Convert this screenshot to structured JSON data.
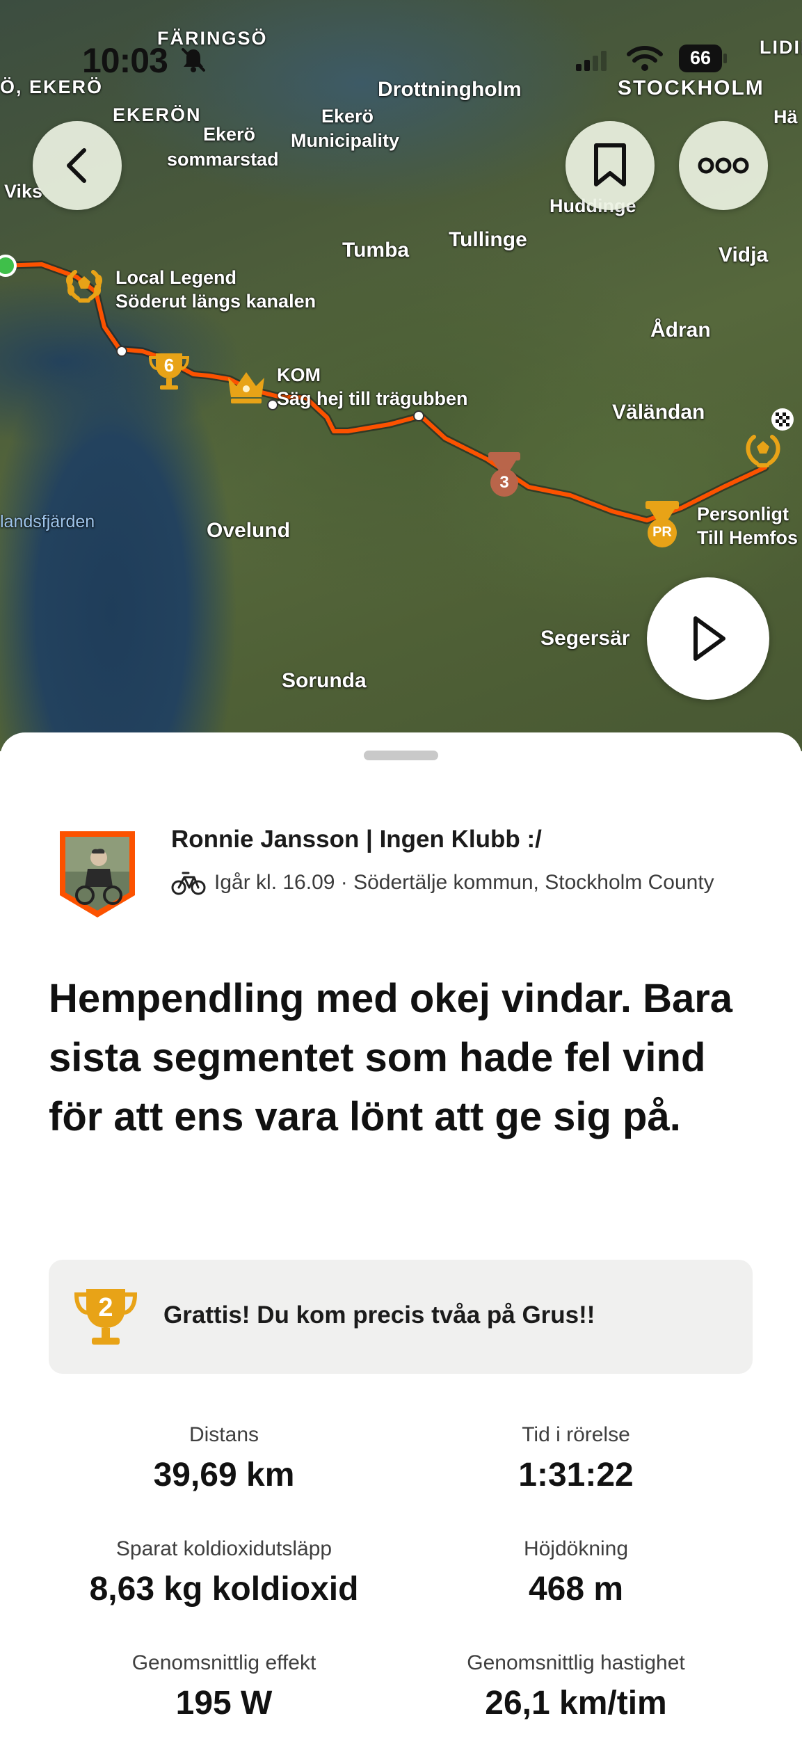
{
  "status_bar": {
    "time": "10:03",
    "battery": "66"
  },
  "map": {
    "place_labels": {
      "faringso": "FÄRINGSÖ",
      "o_ekero": "Ö, EKERÖ",
      "liding": "LIDING",
      "drottningholm": "Drottningholm",
      "stockholm": "STOCKHOLM",
      "ha": "Hä",
      "ekeron": "EKERÖN",
      "ekero_municipality": "Ekerö Municipality",
      "ekero_sommarstad": "Ekerö sommarstad",
      "viks": "Viks",
      "huddinge": "Huddinge",
      "tumba": "Tumba",
      "tullinge": "Tullinge",
      "vidja": "Vidja",
      "adran": "Ådran",
      "valandan": "Väländan",
      "landsfjarden": "landsfjärden",
      "ovelund": "Ovelund",
      "segersar": "Segersär",
      "sorunda": "Sorunda"
    },
    "route_labels": {
      "local_legend_title": "Local Legend",
      "local_legend_segment": "Söderut längs kanalen",
      "kom_title": "KOM",
      "kom_segment": "Säg hej till trägubben",
      "pr_title": "Personligt",
      "pr_segment": "Till Hemfos"
    },
    "medal_numbers": {
      "trophy": "6",
      "medal": "3",
      "pr": "PR"
    },
    "colors": {
      "route": "#fc5200",
      "gold": "#e8a317",
      "bronze": "#b9654a"
    },
    "icons": {
      "back": "chevron-left-icon",
      "bookmark": "bookmark-icon",
      "more": "more-icon",
      "play": "play-icon"
    }
  },
  "activity": {
    "athlete_name": "Ronnie Jansson | Ingen Klubb :/",
    "sport_icon": "bike-icon",
    "meta": "Igår kl. 16.09 · Södertälje kommun, Stockholm County",
    "title": "Hempendling med okej vindar. Bara sista segmentet som hade fel vind för att ens vara lönt att ge sig på.",
    "achievement": {
      "icon": "trophy-icon",
      "rank": "2",
      "text": "Grattis! Du kom precis tvåa på Grus!!"
    },
    "stats": [
      {
        "label": "Distans",
        "value": "39,69 km"
      },
      {
        "label": "Tid i rörelse",
        "value": "1:31:22"
      },
      {
        "label": "Sparat koldioxidutsläpp",
        "value": "8,63 kg koldioxid"
      },
      {
        "label": "Höjdökning",
        "value": "468 m"
      },
      {
        "label": "Genomsnittlig effekt",
        "value": "195 W"
      },
      {
        "label": "Genomsnittlig hastighet",
        "value": "26,1 km/tim"
      }
    ]
  }
}
